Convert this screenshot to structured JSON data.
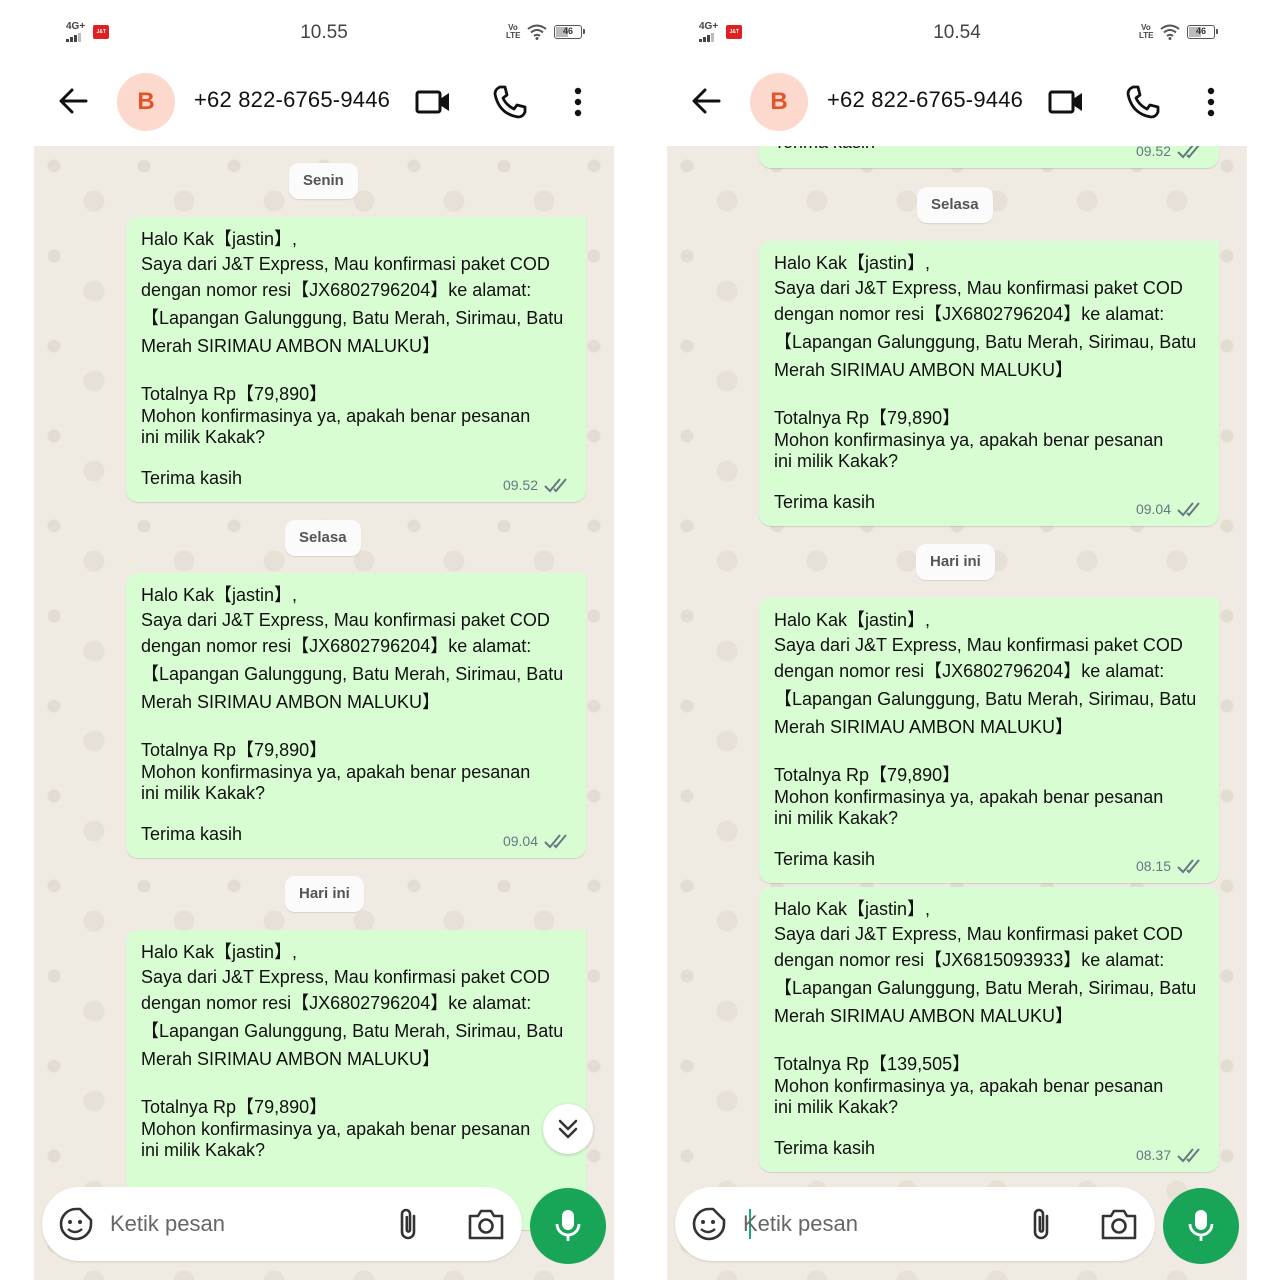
{
  "status": {
    "network": "4G+",
    "left_time": "10.55",
    "right_time": "10.54",
    "volte": "Vo LTE",
    "battery": "46"
  },
  "chat": {
    "contact_initial": "B",
    "contact_name": "+62 822-6765-9446",
    "composer_placeholder": "Ketik pesan"
  },
  "days": {
    "senin": "Senin",
    "selasa": "Selasa",
    "hari_ini": "Hari ini"
  },
  "msg": {
    "greeting": "Halo Kak【jastin】,",
    "intro": "Saya dari J&T Express, Mau konfirmasi paket COD",
    "resi_a": "dengan nomor resi【JX6802796204】ke alamat:",
    "resi_b": "dengan nomor resi【JX6815093933】ke alamat:",
    "addr1": "【Lapangan Galunggung, Batu Merah, Sirimau, Batu",
    "addr2": "Merah  SIRIMAU AMBON MALUKU】",
    "total_a": "Totalnya Rp【79,890】",
    "total_b": "Totalnya Rp【139,505】",
    "confirm": "Mohon konfirmasinya ya, apakah benar pesanan ini milik Kakak?",
    "thanks": "Terima kasih",
    "cut_top": "Terima kasih"
  },
  "times": {
    "t1": "09.52",
    "t2": "09.04",
    "t3": "08.15",
    "t4": "08.37"
  },
  "icons": {
    "back": "arrow-left-icon",
    "video": "video-call-icon",
    "call": "phone-icon",
    "more": "more-vert-icon",
    "emoji": "sticker-icon",
    "attach": "paperclip-icon",
    "camera": "camera-icon",
    "mic": "microphone-icon",
    "read": "double-check-icon",
    "scroll": "double-chevron-down-icon"
  },
  "colors": {
    "bubble": "#d9fdd3",
    "wallpaper": "#efeae2",
    "mic": "#18a558",
    "avatar_bg": "#fcd9cc",
    "avatar_fg": "#e4542a",
    "tick": "#667781"
  }
}
